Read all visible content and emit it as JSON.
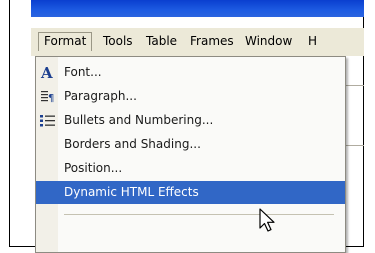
{
  "menubar": {
    "items": [
      "Format",
      "Tools",
      "Table",
      "Frames",
      "Window",
      "H"
    ]
  },
  "format_menu": {
    "items": [
      {
        "label": "Font...",
        "icon": "font-a-icon"
      },
      {
        "label": "Paragraph...",
        "icon": "paragraph-icon"
      },
      {
        "label": "Bullets and Numbering...",
        "icon": "bullets-icon"
      },
      {
        "label": "Borders and Shading...",
        "icon": ""
      },
      {
        "label": "Position...",
        "icon": ""
      },
      {
        "label": "Dynamic HTML Effects",
        "icon": "",
        "highlighted": true
      }
    ]
  },
  "colors": {
    "highlight": "#3167c6",
    "titlebar": "#1d5be2",
    "menubar": "#ece9d8"
  }
}
